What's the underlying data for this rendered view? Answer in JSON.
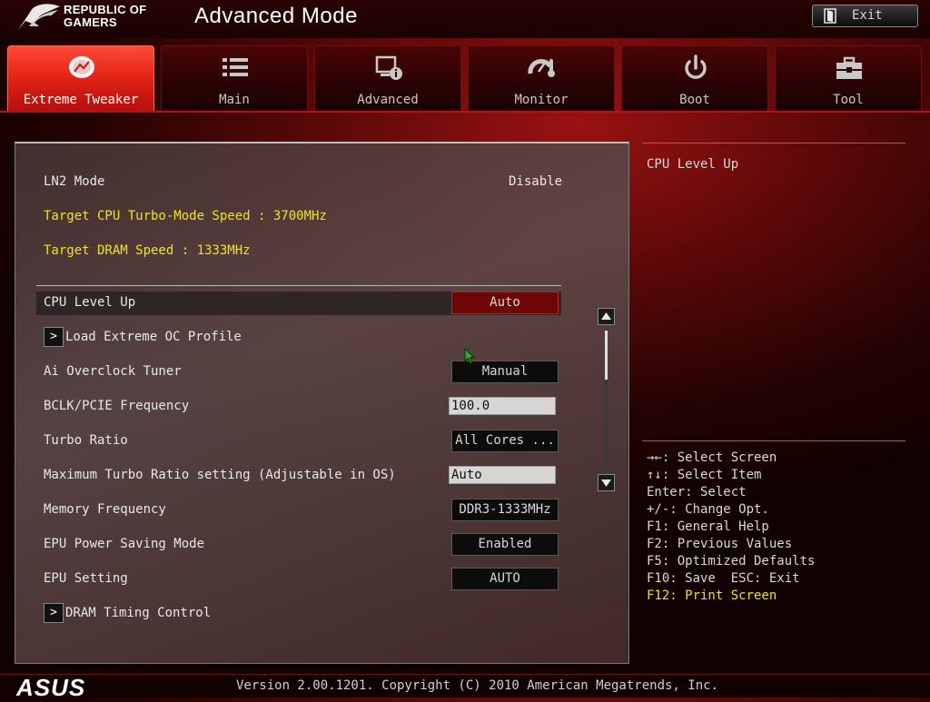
{
  "header": {
    "brand_line1": "REPUBLIC OF",
    "brand_line2": "GAMERS",
    "title": "Advanced Mode",
    "exit_label": "Exit"
  },
  "tabs": [
    {
      "label": "Extreme Tweaker",
      "icon": "meter-icon",
      "active": true
    },
    {
      "label": "Main",
      "icon": "list-icon",
      "active": false
    },
    {
      "label": "Advanced",
      "icon": "chip-info-icon",
      "active": false
    },
    {
      "label": "Monitor",
      "icon": "gauge-thermometer-icon",
      "active": false
    },
    {
      "label": "Boot",
      "icon": "power-icon",
      "active": false
    },
    {
      "label": "Tool",
      "icon": "toolbox-icon",
      "active": false
    }
  ],
  "info": {
    "ln2_label": "LN2 Mode",
    "ln2_value": "Disable",
    "target_cpu": "Target CPU Turbo-Mode Speed : 3700MHz",
    "target_dram": "Target DRAM Speed : 1333MHz"
  },
  "settings": [
    {
      "label": "CPU Level Up",
      "value": "Auto",
      "kind": "select",
      "selected": true
    },
    {
      "label": "Load Extreme OC Profile",
      "kind": "submenu"
    },
    {
      "label": "Ai Overclock Tuner",
      "value": "Manual",
      "kind": "select"
    },
    {
      "label": "BCLK/PCIE Frequency",
      "value": "100.0",
      "kind": "input"
    },
    {
      "label": "Turbo Ratio",
      "value": "All Cores ...",
      "kind": "select"
    },
    {
      "label": "Maximum Turbo Ratio setting (Adjustable in OS)",
      "value": "Auto",
      "kind": "input"
    },
    {
      "label": "Memory Frequency",
      "value": "DDR3-1333MHz",
      "kind": "select"
    },
    {
      "label": "EPU Power Saving Mode",
      "value": "Enabled",
      "kind": "select"
    },
    {
      "label": "EPU Setting",
      "value": "AUTO",
      "kind": "select"
    },
    {
      "label": "DRAM Timing Control",
      "kind": "submenu"
    }
  ],
  "help": {
    "title": "CPU Level Up",
    "keys": [
      "→←: Select Screen",
      "↑↓: Select Item",
      "Enter: Select",
      "+/-: Change Opt.",
      "F1: General Help",
      "F2: Previous Values",
      "F5: Optimized Defaults",
      "F10: Save  ESC: Exit",
      "F12: Print Screen"
    ]
  },
  "footer": {
    "logo": "ASUS",
    "version": "Version 2.00.1201. Copyright (C) 2010 American Megatrends, Inc."
  },
  "colors": {
    "accent_red": "#e52515",
    "highlight_yellow": "#f2e21c",
    "selected_value_bg": "#6e0606"
  },
  "scrollbar": {
    "position_fraction": 0.0
  }
}
